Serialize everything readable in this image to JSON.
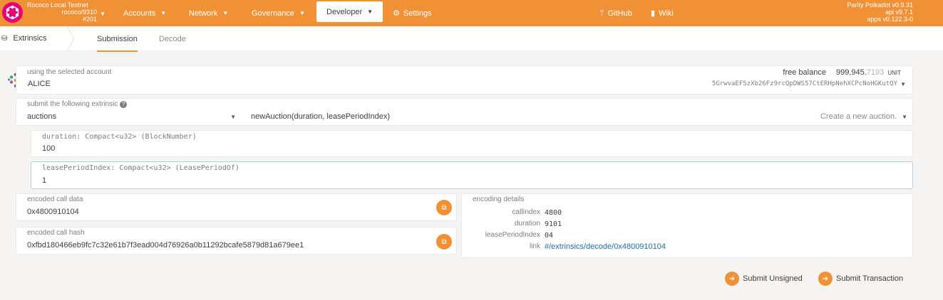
{
  "chain": {
    "name": "Rococo Local Testnet",
    "node": "rococo/9310",
    "block": "#201"
  },
  "nav": {
    "accounts": "Accounts",
    "network": "Network",
    "governance": "Governance",
    "developer": "Developer",
    "settings": "Settings",
    "github": "GitHub",
    "wiki": "Wiki"
  },
  "version": {
    "line1": "Parity Polkadot v0.9.31",
    "line2": "api v9.7.1",
    "line3": "apps v0.122.3-0"
  },
  "tabs": {
    "section": "Extrinsics",
    "submission": "Submission",
    "decode": "Decode"
  },
  "account": {
    "label": "using the selected account",
    "name": "ALICE",
    "balance_label": "free balance",
    "balance_main": "999,945.",
    "balance_fraction": "7193",
    "balance_unit": "UNIT",
    "address": "5GrwvaEF5zXb26Fz9rcQpDWS57CtERHpNehXCPcNoHGKutQY"
  },
  "extrinsic": {
    "label": "submit the following extrinsic",
    "module": "auctions",
    "call": "newAuction(duration, leasePeriodIndex)",
    "doc": "Create a new auction."
  },
  "params": [
    {
      "label": "duration: Compact<u32> (BlockNumber)",
      "value": "100"
    },
    {
      "label": "leasePeriodIndex: Compact<u32> (LeasePeriodOf)",
      "value": "1"
    }
  ],
  "encoded": {
    "call_data_label": "encoded call data",
    "call_data": "0x4800910104",
    "call_hash_label": "encoded call hash",
    "call_hash": "0xfbd180466eb9fc7c32e61b7f3ead004d76926a0b11292bcafe5879d81a679ee1"
  },
  "details": {
    "title": "encoding details",
    "rows": [
      {
        "key": "callIndex",
        "value": "4800"
      },
      {
        "key": "duration",
        "value": "9101"
      },
      {
        "key": "leasePeriodIndex",
        "value": "04"
      },
      {
        "key": "link",
        "value": "#/extrinsics/decode/0x4800910104"
      }
    ]
  },
  "actions": {
    "unsigned": "Submit Unsigned",
    "transaction": "Submit Transaction"
  },
  "colors": {
    "accent": "#f19135",
    "logo": "#e6007a",
    "link": "#1e6fa8"
  }
}
